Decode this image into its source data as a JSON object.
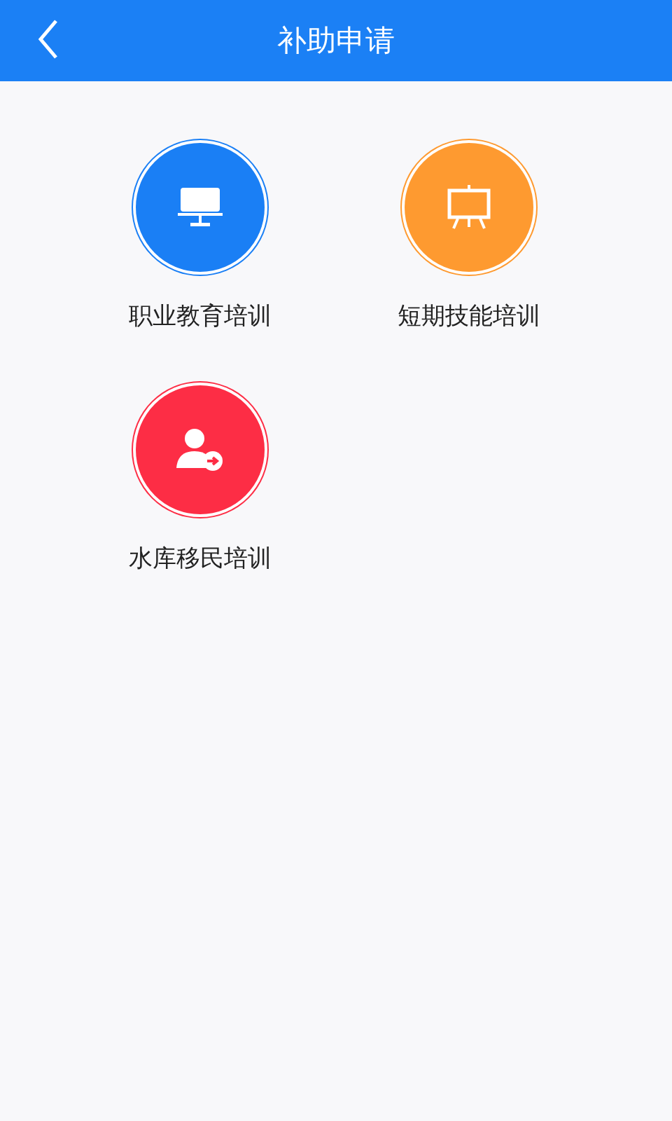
{
  "header": {
    "title": "补助申请"
  },
  "items": [
    {
      "label": "职业教育培训",
      "kind": "monitor",
      "color": "#1a7ff5"
    },
    {
      "label": "短期技能培训",
      "kind": "easel",
      "color": "#fe9a30"
    },
    {
      "label": "水库移民培训",
      "kind": "person",
      "color": "#fd2d45"
    }
  ]
}
